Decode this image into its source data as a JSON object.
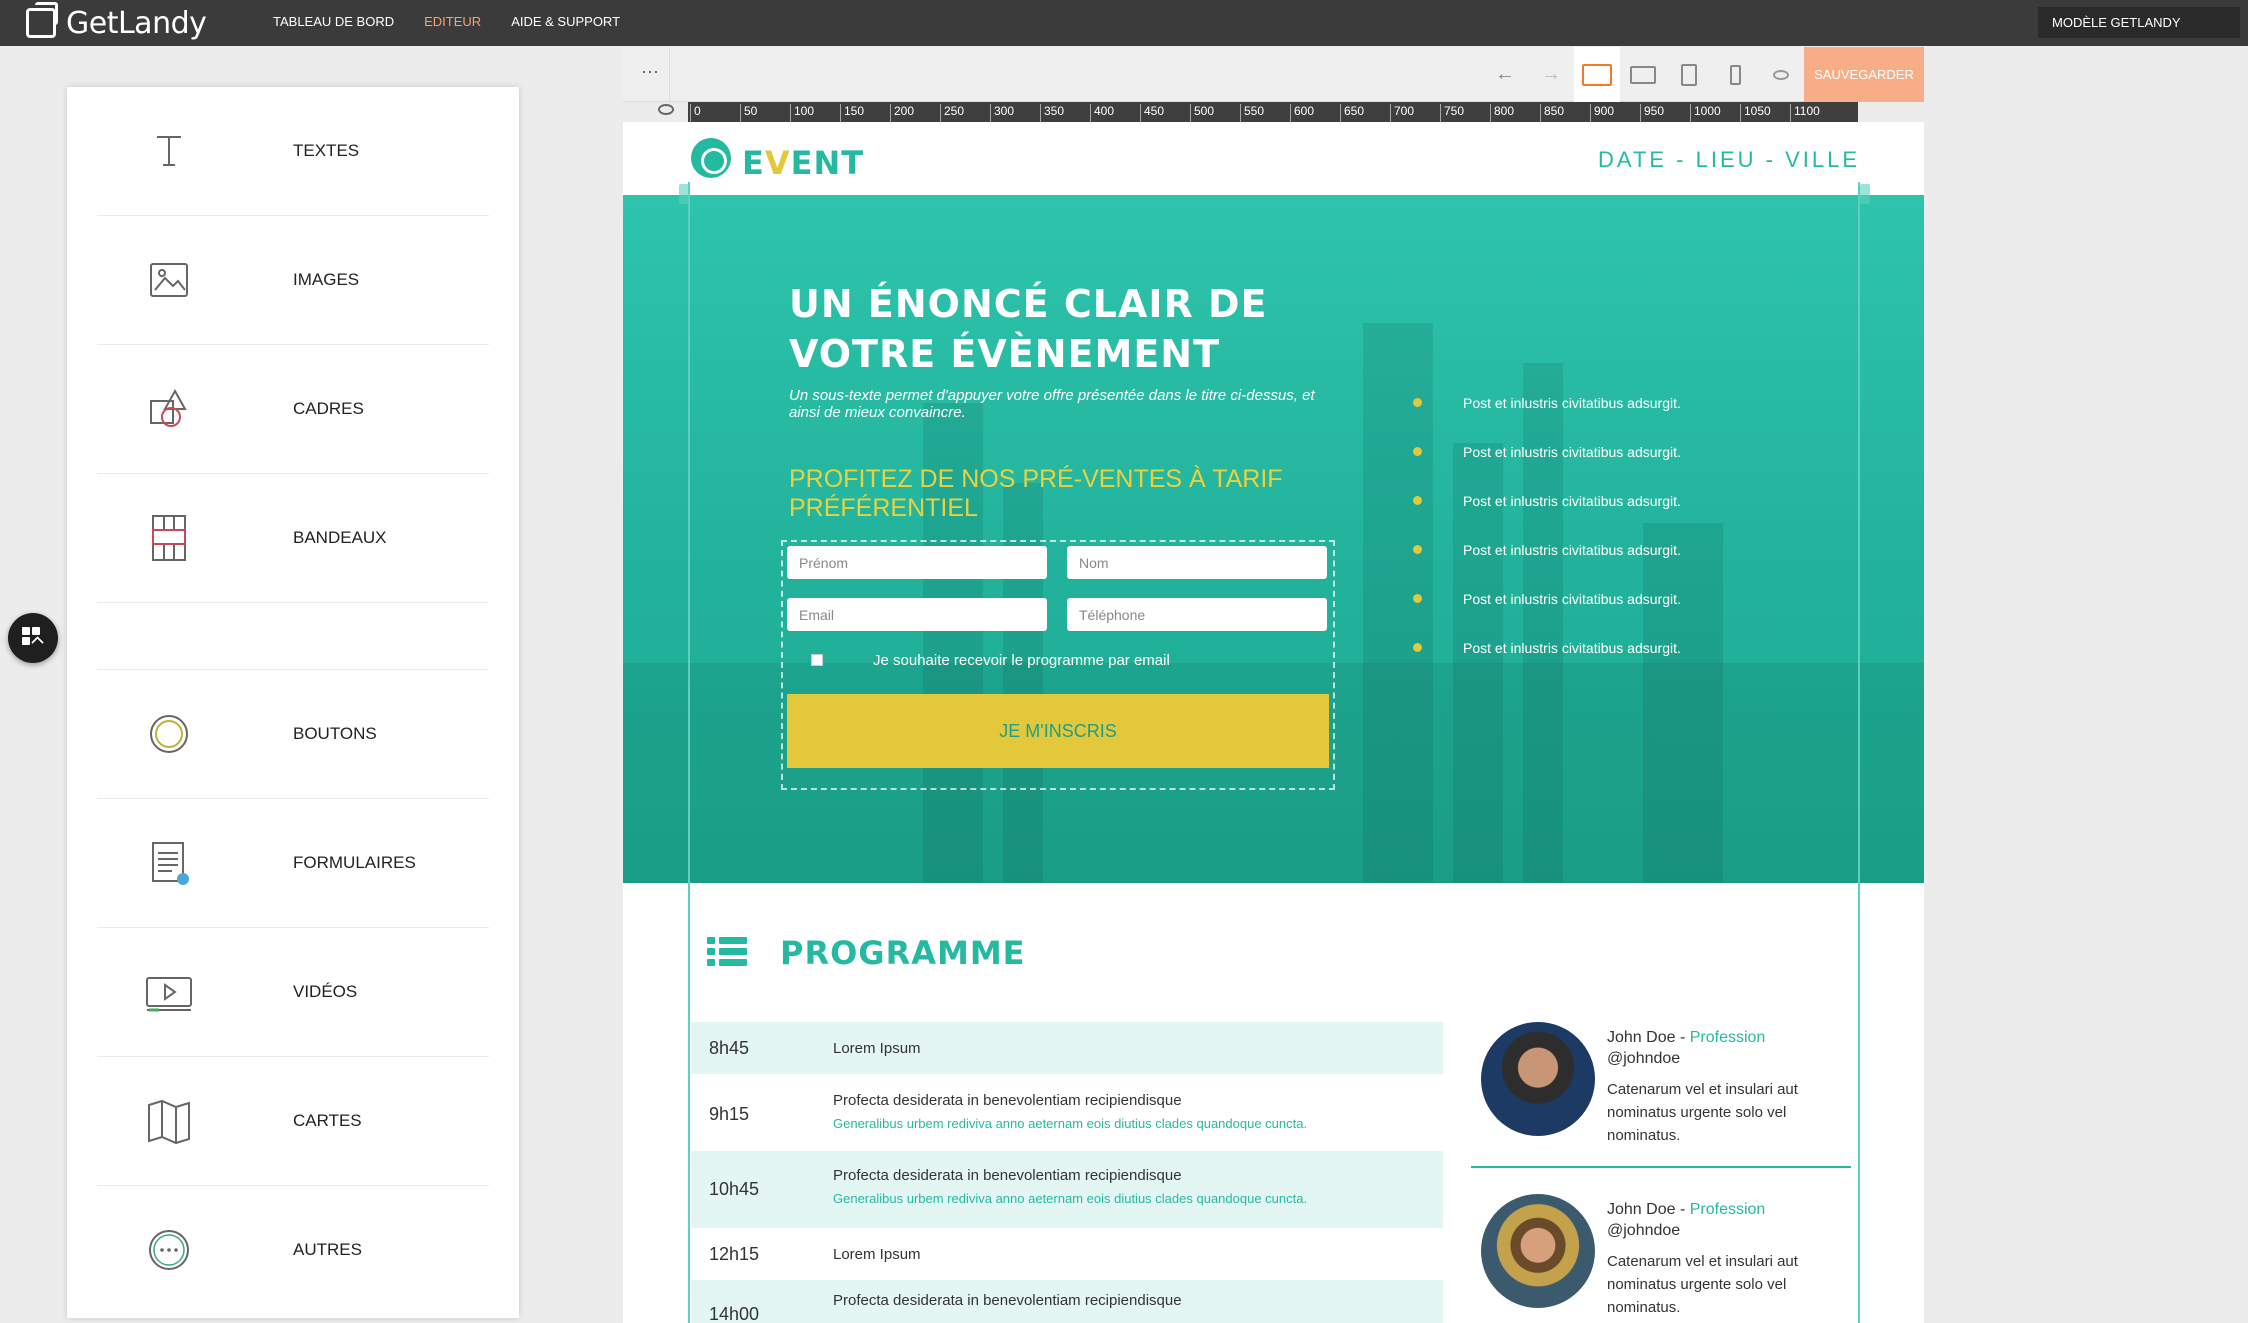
{
  "app": {
    "name": "GetLandy"
  },
  "topnav": [
    {
      "label": "TABLEAU DE BORD",
      "active": false
    },
    {
      "label": "EDITEUR",
      "active": true
    },
    {
      "label": "AIDE & SUPPORT",
      "active": false
    }
  ],
  "model_select": {
    "value": "MODÈLE GETLANDY"
  },
  "sidebar": {
    "items": [
      {
        "label": "TEXTES",
        "icon": "text-icon"
      },
      {
        "label": "IMAGES",
        "icon": "image-icon"
      },
      {
        "label": "CADRES",
        "icon": "shapes-icon"
      },
      {
        "label": "BANDEAUX",
        "icon": "grid-icon"
      },
      {
        "label": "BOUTONS",
        "icon": "button-circle-icon"
      },
      {
        "label": "FORMULAIRES",
        "icon": "form-icon"
      },
      {
        "label": "VIDÉOS",
        "icon": "video-icon"
      },
      {
        "label": "CARTES",
        "icon": "map-icon"
      },
      {
        "label": "AUTRES",
        "icon": "more-icon"
      }
    ]
  },
  "toolbar": {
    "menu_dots": "···",
    "undo": "←",
    "redo": "→",
    "save_label": "SAUVEGARDER",
    "colors": {
      "accent": "#f07a2a",
      "save": "#f7ad86"
    }
  },
  "ruler": {
    "ticks": [
      "0",
      "50",
      "100",
      "150",
      "200",
      "250",
      "300",
      "350",
      "400",
      "450",
      "500",
      "550",
      "600",
      "650",
      "700",
      "750",
      "800",
      "850",
      "900",
      "950",
      "1000",
      "1050",
      "1100"
    ]
  },
  "page": {
    "brand": {
      "prefix": "E",
      "highlight": "V",
      "suffix": "ENT"
    },
    "date_line": "DATE - LIEU - VILLE",
    "hero": {
      "title": "UN ÉNONCÉ CLAIR DE VOTRE ÉVÈNEMENT",
      "subtitle": "Un sous-texte permet d'appuyer votre offre présentée dans le titre ci-dessus, et ainsi de mieux convaincre.",
      "presale": "PROFITEZ DE NOS PRÉ-VENTES À TARIF PRÉFÉRENTIEL",
      "form": {
        "prenom_placeholder": "Prénom",
        "nom_placeholder": "Nom",
        "email_placeholder": "Email",
        "telephone_placeholder": "Téléphone",
        "checkbox_label": "Je souhaite recevoir le programme par email",
        "submit_label": "JE M'INSCRIS"
      },
      "bullets": [
        "Post et inlustris civitatibus adsurgit.",
        "Post et inlustris civitatibus adsurgit.",
        "Post et inlustris civitatibus adsurgit.",
        "Post et inlustris civitatibus adsurgit.",
        "Post et inlustris civitatibus adsurgit.",
        "Post et inlustris civitatibus adsurgit."
      ]
    },
    "programme": {
      "title": "PROGRAMME",
      "rows": [
        {
          "time": "8h45",
          "title": "Lorem Ipsum",
          "subtitle": ""
        },
        {
          "time": "9h15",
          "title": "Profecta desiderata in benevolentiam recipiendisque",
          "subtitle": "Generalibus urbem rediviva anno aeternam eois diutius clades quandoque cuncta."
        },
        {
          "time": "10h45",
          "title": "Profecta desiderata in benevolentiam recipiendisque",
          "subtitle": "Generalibus urbem rediviva anno aeternam eois diutius clades quandoque cuncta."
        },
        {
          "time": "12h15",
          "title": "Lorem Ipsum",
          "subtitle": ""
        },
        {
          "time": "14h00",
          "title": "Profecta desiderata in benevolentiam recipiendisque",
          "subtitle": ""
        }
      ]
    },
    "speakers": [
      {
        "name": "John Doe - ",
        "profession": "Profession",
        "handle": "@johndoe",
        "bio": "Catenarum vel et insulari aut nominatus urgente solo vel nominatus."
      },
      {
        "name": "John Doe - ",
        "profession": "Profession",
        "handle": "@johndoe",
        "bio": "Catenarum vel et insulari aut nominatus urgente solo vel nominatus."
      }
    ],
    "colors": {
      "teal": "#25b9a2",
      "yellow": "#e2c83a"
    }
  }
}
